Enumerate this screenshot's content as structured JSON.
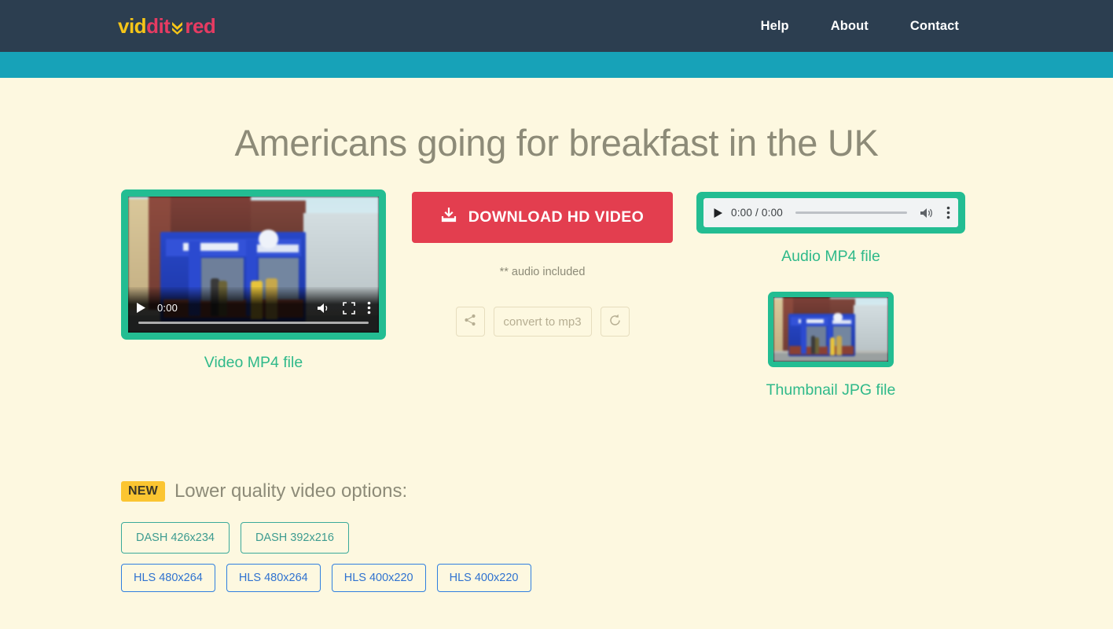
{
  "header": {
    "brand": {
      "part1": "vid",
      "part2": "dit",
      "icon": "chevron-down-double-icon",
      "part3": "red"
    },
    "nav": [
      {
        "label": "Help",
        "name": "nav-link-help"
      },
      {
        "label": "About",
        "name": "nav-link-about"
      },
      {
        "label": "Contact",
        "name": "nav-link-contact"
      }
    ],
    "colors": {
      "navbar_bg": "#2c3e50",
      "subbar_bg": "#17a2b8",
      "brand_yellow": "#f5c518",
      "brand_pink": "#e63b62"
    }
  },
  "page": {
    "background": "#fdf8e0",
    "title": "Americans going for breakfast in the UK"
  },
  "video": {
    "caption": "Video MP4 file",
    "current_time": "0:00",
    "controls": {
      "play": "play-icon",
      "volume": "volume-icon",
      "fullscreen": "fullscreen-icon",
      "menu": "kebab-menu-icon"
    },
    "border_color": "#23bd92",
    "caption_color": "#2fb98a"
  },
  "download": {
    "button_label": "DOWNLOAD HD VIDEO",
    "button_icon": "download-icon",
    "button_color": "#e33e4f",
    "audio_note": "** audio included",
    "tools": {
      "share_icon": "share-icon",
      "convert_label": "convert to mp3",
      "refresh_icon": "refresh-icon"
    }
  },
  "audio": {
    "caption": "Audio MP4 file",
    "time_display": "0:00 / 0:00",
    "controls": {
      "play": "play-icon",
      "volume": "volume-icon",
      "menu": "kebab-menu-icon"
    }
  },
  "thumbnail": {
    "caption": "Thumbnail JPG file"
  },
  "lower": {
    "badge": "NEW",
    "title": "Lower quality video options:",
    "dash_options": [
      {
        "label": "DASH 426x234"
      },
      {
        "label": "DASH 392x216"
      }
    ],
    "hls_options": [
      {
        "label": "HLS 480x264"
      },
      {
        "label": "HLS 480x264"
      },
      {
        "label": "HLS 400x220"
      },
      {
        "label": "HLS 400x220"
      }
    ],
    "badge_color": "#fbc531",
    "dash_color": "#3c9b90",
    "hls_color": "#2f72d0"
  }
}
